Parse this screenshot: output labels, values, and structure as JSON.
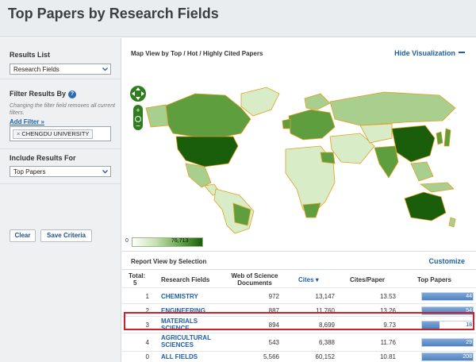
{
  "header": {
    "title": "Top Papers by Research Fields"
  },
  "sidebar": {
    "results_list": {
      "label": "Results List",
      "value": "Research Fields"
    },
    "filter": {
      "label": "Filter Results By",
      "help_icon": "?",
      "note": "Changing the filter field removes all current filters.",
      "add_filter": "Add Filter »",
      "chip_x": "×",
      "chip": "CHENGDU UNIVERSITY"
    },
    "include": {
      "label": "Include Results For",
      "value": "Top Papers"
    },
    "buttons": {
      "clear": "Clear",
      "save": "Save Criteria"
    }
  },
  "map": {
    "title": "Map View by Top / Hot / Highly Cited Papers",
    "hide": "Hide Visualization",
    "legend_min": "0",
    "legend_max": "76,713",
    "colors": {
      "dark": "#1a5e0c",
      "mid": "#5f9e3f",
      "light": "#a9cf8e",
      "pale": "#d9ecc8",
      "border": "#e0a020"
    }
  },
  "report": {
    "title": "Report View by Selection",
    "customize": "Customize",
    "columns": {
      "total_label": "Total:",
      "total_value": "5",
      "field": "Research Fields",
      "wos": "Web of Science Documents",
      "cites": "Cites",
      "cites_arrow": "▾",
      "cites_per_paper": "Cites/Paper",
      "top_papers": "Top Papers"
    },
    "rows": [
      {
        "rank": "1",
        "field": "CHEMISTRY",
        "wos": "972",
        "cites": "13,147",
        "cpp": "13.53",
        "top": "44",
        "fill": 1.0
      },
      {
        "rank": "2",
        "field": "ENGINEERING",
        "wos": "887",
        "cites": "11,760",
        "cpp": "13.26",
        "top": "54",
        "fill": 1.0
      },
      {
        "rank": "3",
        "field": "MATERIALS SCIENCE",
        "wos": "894",
        "cites": "8,699",
        "cpp": "9.73",
        "top": "18",
        "fill": 0.34
      },
      {
        "rank": "4",
        "field": "AGRICULTURAL SCIENCES",
        "wos": "543",
        "cites": "6,388",
        "cpp": "11.76",
        "top": "29",
        "fill": 1.0
      },
      {
        "rank": "0",
        "field": "ALL FIELDS",
        "wos": "5,566",
        "cites": "60,152",
        "cpp": "10.81",
        "top": "208",
        "fill": 1.0
      }
    ]
  }
}
